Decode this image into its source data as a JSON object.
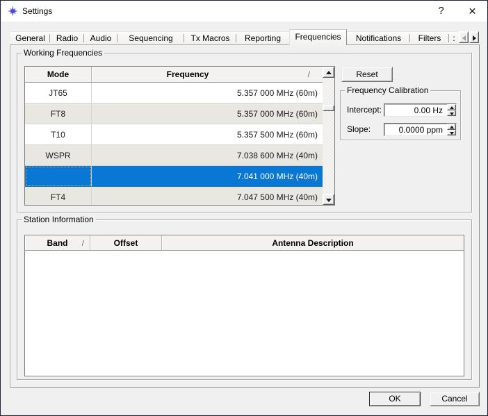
{
  "window": {
    "title": "Settings",
    "help_glyph": "?",
    "close_glyph": "✕"
  },
  "tabs": [
    {
      "label": "General"
    },
    {
      "label": "Radio"
    },
    {
      "label": "Audio"
    },
    {
      "label": "Sequencing"
    },
    {
      "label": "Tx Macros"
    },
    {
      "label": "Reporting"
    },
    {
      "label": "Frequencies",
      "selected": true
    },
    {
      "label": "Notifications"
    },
    {
      "label": "Filters"
    },
    {
      "label": ":"
    }
  ],
  "working_frequencies": {
    "group_label": "Working Frequencies",
    "table": {
      "columns": [
        "Mode",
        "Frequency"
      ],
      "sort_indicator": "/",
      "rows": [
        {
          "mode": "JT65",
          "frequency": "5.357 000 MHz (60m)"
        },
        {
          "mode": "FT8",
          "frequency": "5.357 000 MHz (60m)"
        },
        {
          "mode": "T10",
          "frequency": "5.357 500 MHz (60m)"
        },
        {
          "mode": "WSPR",
          "frequency": "7.038 600 MHz (40m)"
        },
        {
          "mode": "",
          "frequency": "7.041 000 MHz (40m)",
          "selected": true
        },
        {
          "mode": "FT4",
          "frequency": "7.047 500 MHz (40m)"
        }
      ]
    },
    "reset_label": "Reset",
    "calibration": {
      "group_label": "Frequency Calibration",
      "intercept_label": "Intercept:",
      "intercept_value": "0.00 Hz",
      "slope_label": "Slope:",
      "slope_value": "0.0000 ppm"
    }
  },
  "station_information": {
    "group_label": "Station Information",
    "table": {
      "columns": [
        "Band",
        "Offset",
        "Antenna Description"
      ],
      "sort_indicator": "/",
      "rows": []
    }
  },
  "buttons": {
    "ok": "OK",
    "cancel": "Cancel"
  },
  "colors": {
    "selection": "#0878d4",
    "dialog_background": "#f0f0f0",
    "titlebar_background": "#ffffff",
    "alternate_row": "#e9e7e2",
    "icon_blue": "#3a3ae0"
  }
}
